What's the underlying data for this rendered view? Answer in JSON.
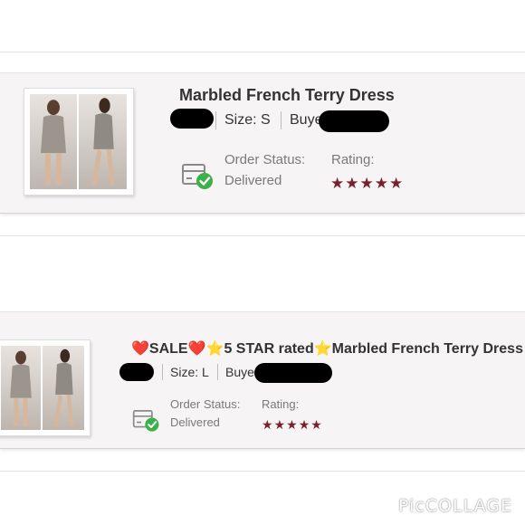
{
  "listing_1": {
    "title": "Marbled French Terry Dress",
    "size": "Size: S",
    "buyer_prefix": "Buye",
    "order_status_label": "Order Status:",
    "order_status_value": "Delivered",
    "rating_label": "Rating:",
    "rating_value": 5
  },
  "listing_2": {
    "title_heart_1": "❤️",
    "title_sale": "SALE",
    "title_heart_2": "❤️",
    "title_star_1": "⭐",
    "title_rated": "5 STAR rated",
    "title_star_2": "⭐",
    "title_name": "Marbled French Terry Dress",
    "size": "Size: L",
    "buyer_prefix": "Buye",
    "order_status_label": "Order Status:",
    "order_status_value": "Delivered",
    "rating_label": "Rating:",
    "rating_value": 5
  },
  "icons": {
    "order_status": "delivered-box-check-icon",
    "rating": "star-icon"
  },
  "colors": {
    "star": "#7b1f2e",
    "check": "#3cb04a",
    "card_bg": "#f6f4f4"
  },
  "watermark": "PicCOLLAGE"
}
